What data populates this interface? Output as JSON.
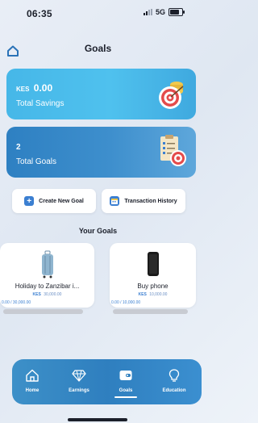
{
  "status": {
    "time": "06:35",
    "network": "5G"
  },
  "header": {
    "title": "Goals"
  },
  "savings": {
    "currency": "KES",
    "amount": "0.00",
    "label": "Total Savings"
  },
  "goals_card": {
    "count": "2",
    "label": "Total Goals"
  },
  "actions": {
    "create": "Create New Goal",
    "history": "Transaction History"
  },
  "section": {
    "title": "Your Goals"
  },
  "goals": [
    {
      "name": "Holiday to Zanzibar i...",
      "target_currency": "KES",
      "target_value": "30,000.00",
      "progress": "0.00 / 30,000.00"
    },
    {
      "name": "Buy phone",
      "target_currency": "KES",
      "target_value": "10,000.00",
      "progress": "0.00 / 10,000.00"
    }
  ],
  "tabs": [
    {
      "label": "Home",
      "icon": "home-icon"
    },
    {
      "label": "Earnings",
      "icon": "diamond-icon"
    },
    {
      "label": "Goals",
      "icon": "wallet-icon"
    },
    {
      "label": "Education",
      "icon": "lightbulb-icon"
    }
  ],
  "colors": {
    "accent": "#3b7fd1",
    "savings_card": "#46b7e8",
    "goals_card": "#2e80c2",
    "tabbar": "#2f7fbf"
  }
}
